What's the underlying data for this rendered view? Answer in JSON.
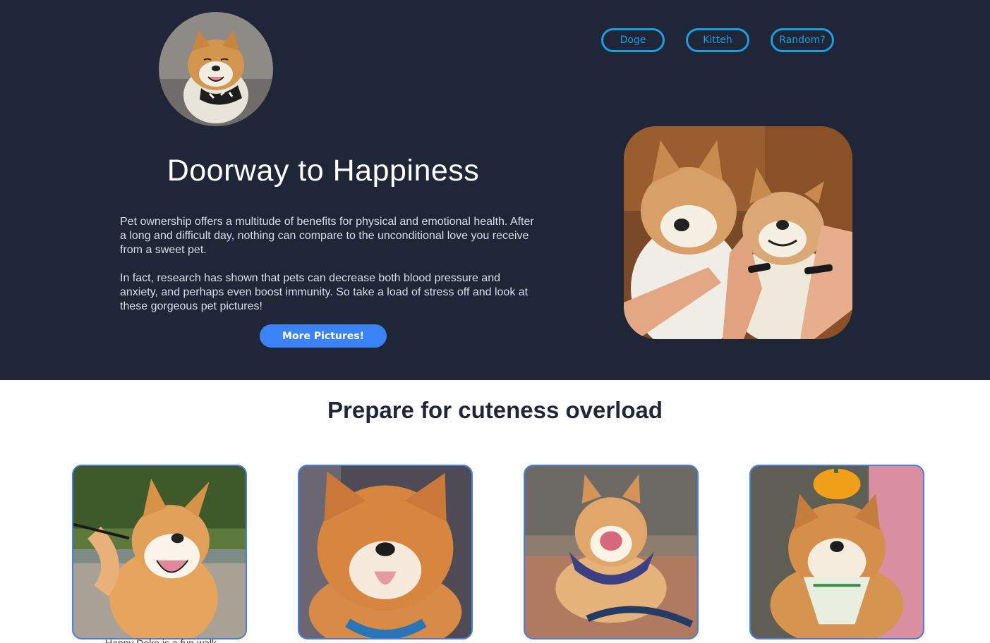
{
  "nav": [
    {
      "label": "Doge"
    },
    {
      "label": "Kitteh"
    },
    {
      "label": "Random?"
    }
  ],
  "hero": {
    "title": "Doorway to Happiness",
    "paragraph1": "Pet ownership offers a multitude of benefits for physical and emotional health. After a long and difficult day, nothing can compare to the unconditional love you receive from a sweet pet.",
    "paragraph2": "In fact, research has shown that pets can decrease both blood pressure and anxiety, and perhaps even boost immunity. So take a load of stress off and look at these gorgeous pet pictures!",
    "cta_label": "More Pictures!"
  },
  "gallery": {
    "title": "Prepare for cuteness overload",
    "first_caption": "Happy Doke is a fun walk"
  },
  "colors": {
    "hero_bg": "#1f2637",
    "accent_blue": "#1a9fe0",
    "button_blue": "#3b82f6",
    "card_border": "#4a7de0"
  }
}
